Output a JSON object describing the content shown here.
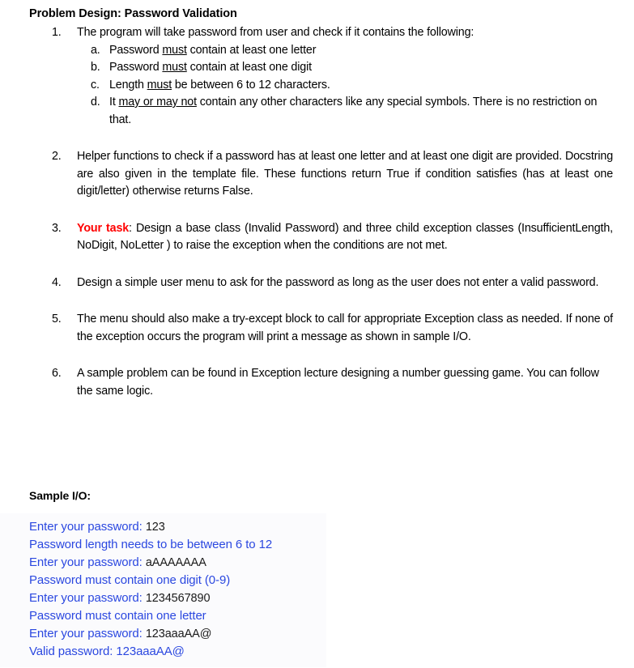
{
  "document": {
    "title": "Problem Design: Password Validation",
    "sample_io_heading": "Sample I/O:"
  },
  "items": [
    {
      "marker": "1.",
      "text": "The program will take password from user and check if it contains the following:",
      "subitems": [
        {
          "marker": "a.",
          "before": "Password ",
          "underlined": "must",
          "after": " contain at least one letter"
        },
        {
          "marker": "b.",
          "before": "Password ",
          "underlined": "must",
          "after": " contain at least one digit"
        },
        {
          "marker": "c.",
          "before": "Length ",
          "underlined": "must",
          "after": " be between 6 to 12 characters."
        },
        {
          "marker": "d.",
          "before": "It ",
          "underlined": "may or may not",
          "after": " contain any other characters like any special symbols. There is no restriction on that."
        }
      ]
    },
    {
      "marker": "2.",
      "text": "Helper functions to check if a password has at least one letter and at least one digit are provided. Docstring are also given in the template file. These functions return True if condition satisfies (has at least one digit/letter) otherwise returns False."
    },
    {
      "marker": "3.",
      "highlight": "Your task",
      "text": ": Design a base class (Invalid Password) and three child exception classes (InsufficientLength, NoDigit, NoLetter ) to raise the exception when the conditions are not met."
    },
    {
      "marker": "4.",
      "text": "Design a simple user menu to ask for the password as long as the user does not enter a valid password."
    },
    {
      "marker": "5.",
      "text": "The menu should also make a try-except block to call for appropriate Exception class as needed. If none of the exception occurs the program will print a message as shown in sample I/O."
    },
    {
      "marker": "6.",
      "text": "A sample problem can be found in Exception lecture designing a number guessing game. You can follow the same logic."
    }
  ],
  "sample_io": {
    "lines": [
      {
        "prompt": "Enter your password: ",
        "typed": "123"
      },
      {
        "prompt": "Password length needs to be between 6 to 12",
        "typed": ""
      },
      {
        "prompt": "Enter your password: ",
        "typed": "aAAAAAAA"
      },
      {
        "prompt": "Password must contain one digit (0-9)",
        "typed": ""
      },
      {
        "prompt": "Enter your password: ",
        "typed": "1234567890"
      },
      {
        "prompt": "Password must contain one letter",
        "typed": ""
      },
      {
        "prompt": "Enter your password: ",
        "typed": "123aaaAA@"
      },
      {
        "prompt": "Valid password: 123aaaAA@",
        "typed": ""
      }
    ]
  },
  "colors": {
    "text": "#000000",
    "highlight_red": "#FF0000",
    "console_blue": "#2B48E0",
    "typed_black": "#1a1a1a",
    "io_background": "#fbfbfd",
    "page_background": "#ffffff"
  }
}
